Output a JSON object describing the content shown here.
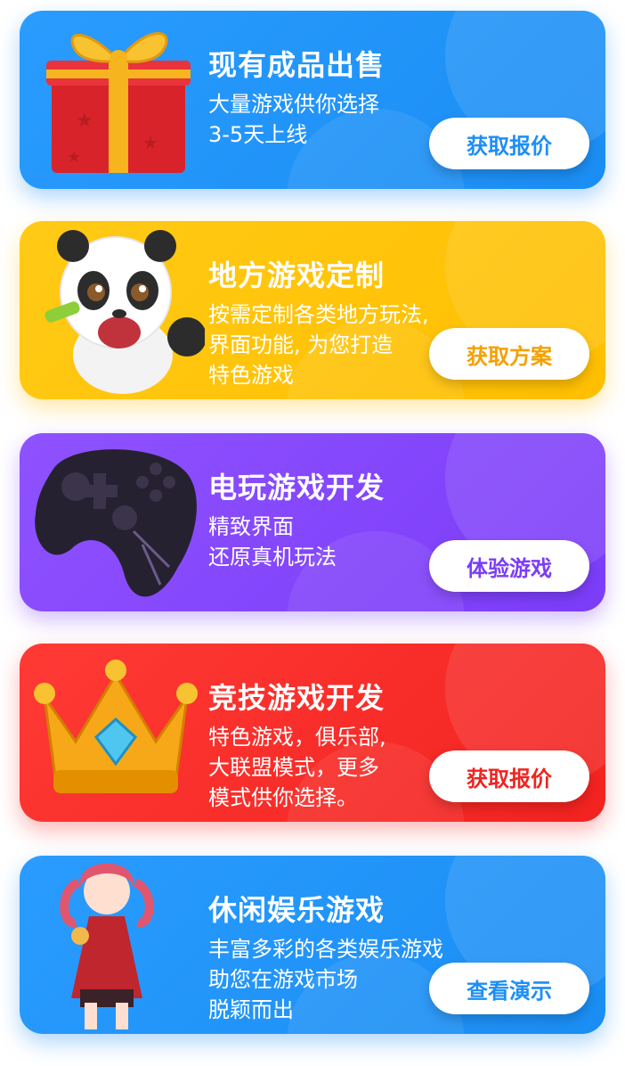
{
  "cards": [
    {
      "title": "现有成品出售",
      "description": "大量游戏供你选择\n3-5天上线",
      "button": "获取报价",
      "image": "gift-box-icon",
      "color": "#1f93f8"
    },
    {
      "title": "地方游戏定制",
      "description": "按需定制各类地方玩法,\n界面功能, 为您打造\n特色游戏",
      "button": "获取方案",
      "image": "panda-mascot-icon",
      "color": "#ffc20a"
    },
    {
      "title": "电玩游戏开发",
      "description": "精致界面\n还原真机玩法",
      "button": "体验游戏",
      "image": "game-controller-icon",
      "color": "#8446fb"
    },
    {
      "title": "竞技游戏开发",
      "description": "特色游戏，俱乐部,\n大联盟模式，更多\n模式供你选择。",
      "button": "获取报价",
      "image": "crown-icon",
      "color": "#f52b27"
    },
    {
      "title": "休闲娱乐游戏",
      "description": "丰富多彩的各类娱乐游戏\n助您在游戏市场\n脱颖而出",
      "button": "查看演示",
      "image": "anime-girl-character",
      "color": "#1f93f8"
    }
  ]
}
